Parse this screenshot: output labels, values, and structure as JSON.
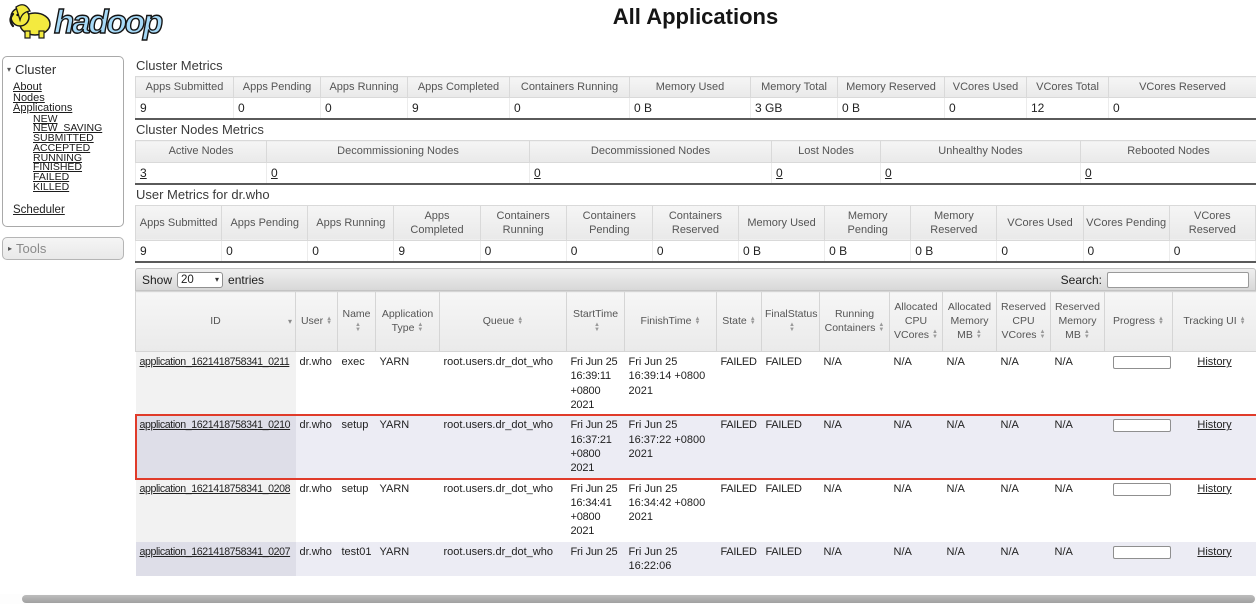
{
  "header": {
    "logo_text": "hadoop",
    "title": "All Applications"
  },
  "sidebar": {
    "cluster_section": {
      "label": "Cluster",
      "links": [
        "About",
        "Nodes",
        "Applications"
      ],
      "application_states": [
        "NEW",
        "NEW_SAVING",
        "SUBMITTED",
        "ACCEPTED",
        "RUNNING",
        "FINISHED",
        "FAILED",
        "KILLED"
      ],
      "scheduler_link": "Scheduler"
    },
    "tools_section": {
      "label": "Tools"
    }
  },
  "cluster_metrics": {
    "title": "Cluster Metrics",
    "headers": [
      "Apps Submitted",
      "Apps Pending",
      "Apps Running",
      "Apps Completed",
      "Containers Running",
      "Memory Used",
      "Memory Total",
      "Memory Reserved",
      "VCores Used",
      "VCores Total",
      "VCores Reserved"
    ],
    "values": [
      "9",
      "0",
      "0",
      "9",
      "0",
      "0 B",
      "3 GB",
      "0 B",
      "0",
      "12",
      "0"
    ]
  },
  "cluster_nodes_metrics": {
    "title": "Cluster Nodes Metrics",
    "headers": [
      "Active Nodes",
      "Decommissioning Nodes",
      "Decommissioned Nodes",
      "Lost Nodes",
      "Unhealthy Nodes",
      "Rebooted Nodes"
    ],
    "values": [
      "3",
      "0",
      "0",
      "0",
      "0",
      "0"
    ]
  },
  "user_metrics": {
    "title": "User Metrics for dr.who",
    "headers": [
      "Apps Submitted",
      "Apps Pending",
      "Apps Running",
      "Apps Completed",
      "Containers Running",
      "Containers Pending",
      "Containers Reserved",
      "Memory Used",
      "Memory Pending",
      "Memory Reserved",
      "VCores Used",
      "VCores Pending",
      "VCores Reserved"
    ],
    "values": [
      "9",
      "0",
      "0",
      "9",
      "0",
      "0",
      "0",
      "0 B",
      "0 B",
      "0 B",
      "0",
      "0",
      "0"
    ]
  },
  "table_controls": {
    "show_label": "Show",
    "page_size": "20",
    "entries_label": "entries",
    "search_label": "Search:",
    "search_value": ""
  },
  "apps_table": {
    "columns": [
      {
        "label": "ID",
        "sorted": "desc"
      },
      {
        "label": "User",
        "sorted": "both"
      },
      {
        "label": "Name",
        "sorted": "both"
      },
      {
        "label": "Application Type",
        "sorted": "both"
      },
      {
        "label": "Queue",
        "sorted": "both"
      },
      {
        "label": "StartTime",
        "sorted": "both"
      },
      {
        "label": "FinishTime",
        "sorted": "both"
      },
      {
        "label": "State",
        "sorted": "both"
      },
      {
        "label": "FinalStatus",
        "sorted": "both"
      },
      {
        "label": "Running Containers",
        "sorted": "both"
      },
      {
        "label": "Allocated CPU VCores",
        "sorted": "both"
      },
      {
        "label": "Allocated Memory MB",
        "sorted": "both"
      },
      {
        "label": "Reserved CPU VCores",
        "sorted": "both"
      },
      {
        "label": "Reserved Memory MB",
        "sorted": "both"
      },
      {
        "label": "Progress",
        "sorted": "both"
      },
      {
        "label": "Tracking UI",
        "sorted": "both"
      }
    ],
    "rows": [
      {
        "id": "application_1621418758341_0211",
        "user": "dr.who",
        "name": "exec",
        "application_type": "YARN",
        "queue": "root.users.dr_dot_who",
        "start_time": "Fri Jun 25 16:39:11 +0800 2021",
        "finish_time": "Fri Jun 25 16:39:14 +0800 2021",
        "state": "FAILED",
        "final_status": "FAILED",
        "running_containers": "N/A",
        "allocated_cpu_vcores": "N/A",
        "allocated_memory_mb": "N/A",
        "reserved_cpu_vcores": "N/A",
        "reserved_memory_mb": "N/A",
        "progress_percent": 0,
        "tracking_ui": "History",
        "highlighted": false
      },
      {
        "id": "application_1621418758341_0210",
        "user": "dr.who",
        "name": "setup",
        "application_type": "YARN",
        "queue": "root.users.dr_dot_who",
        "start_time": "Fri Jun 25 16:37:21 +0800 2021",
        "finish_time": "Fri Jun 25 16:37:22 +0800 2021",
        "state": "FAILED",
        "final_status": "FAILED",
        "running_containers": "N/A",
        "allocated_cpu_vcores": "N/A",
        "allocated_memory_mb": "N/A",
        "reserved_cpu_vcores": "N/A",
        "reserved_memory_mb": "N/A",
        "progress_percent": 0,
        "tracking_ui": "History",
        "highlighted": true
      },
      {
        "id": "application_1621418758341_0208",
        "user": "dr.who",
        "name": "setup",
        "application_type": "YARN",
        "queue": "root.users.dr_dot_who",
        "start_time": "Fri Jun 25 16:34:41 +0800 2021",
        "finish_time": "Fri Jun 25 16:34:42 +0800 2021",
        "state": "FAILED",
        "final_status": "FAILED",
        "running_containers": "N/A",
        "allocated_cpu_vcores": "N/A",
        "allocated_memory_mb": "N/A",
        "reserved_cpu_vcores": "N/A",
        "reserved_memory_mb": "N/A",
        "progress_percent": 0,
        "tracking_ui": "History",
        "highlighted": false
      },
      {
        "id": "application_1621418758341_0207",
        "user": "dr.who",
        "name": "test01",
        "application_type": "YARN",
        "queue": "root.users.dr_dot_who",
        "start_time": "Fri Jun 25",
        "finish_time": "Fri Jun 25 16:22:06",
        "state": "FAILED",
        "final_status": "FAILED",
        "running_containers": "N/A",
        "allocated_cpu_vcores": "N/A",
        "allocated_memory_mb": "N/A",
        "reserved_cpu_vcores": "N/A",
        "reserved_memory_mb": "N/A",
        "progress_percent": 0,
        "tracking_ui": "History",
        "highlighted": false
      }
    ]
  },
  "colors": {
    "highlight_border": "#e03b2a",
    "row_stripe": "#ececf4",
    "sorted_column_odd": "#f2f2f2",
    "sorted_column_even": "#dedee8",
    "logo_text_blue": "#a6d9f7",
    "logo_elephant_yellow": "#f3ea3f",
    "link": "#222222"
  }
}
